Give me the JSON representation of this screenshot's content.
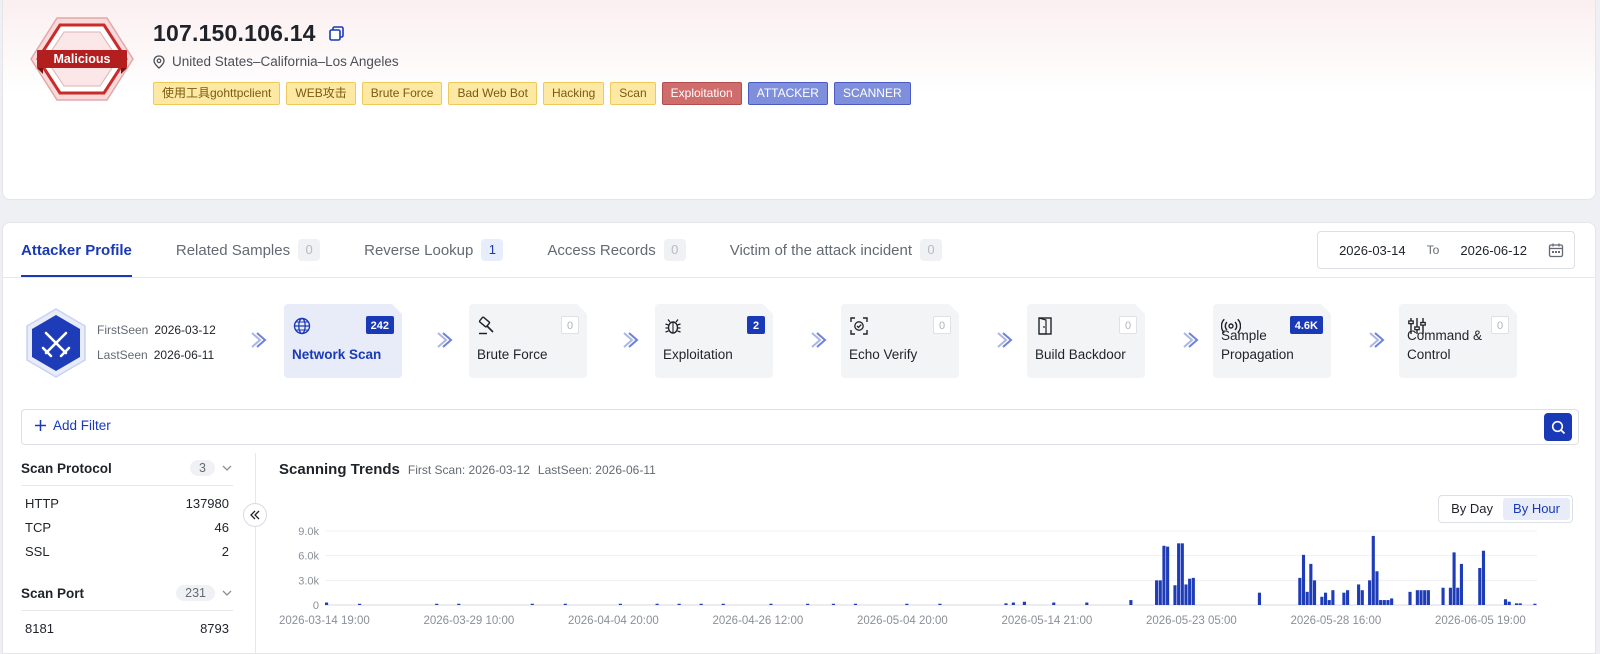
{
  "header": {
    "verdict_badge": "Malicious",
    "ip": "107.150.106.14",
    "location": "United States–California–Los Angeles",
    "tags": [
      {
        "label": "使用工具gohttpclient",
        "style": "yellow"
      },
      {
        "label": "WEB攻击",
        "style": "yellow"
      },
      {
        "label": "Brute Force",
        "style": "yellow"
      },
      {
        "label": "Bad Web Bot",
        "style": "yellow"
      },
      {
        "label": "Hacking",
        "style": "yellow"
      },
      {
        "label": "Scan",
        "style": "yellow"
      },
      {
        "label": "Exploitation",
        "style": "red"
      },
      {
        "label": "ATTACKER",
        "style": "blue"
      },
      {
        "label": "SCANNER",
        "style": "blue"
      }
    ]
  },
  "tabs": [
    {
      "label": "Attacker Profile",
      "active": true
    },
    {
      "label": "Related Samples",
      "count": "0"
    },
    {
      "label": "Reverse Lookup",
      "count": "1"
    },
    {
      "label": "Access Records",
      "count": "0"
    },
    {
      "label": "Victim of the attack incident",
      "count": "0"
    }
  ],
  "date_range": {
    "from": "2026-03-14",
    "to_label": "To",
    "to": "2026-06-12"
  },
  "attacker": {
    "first_seen_label": "FirstSeen",
    "first_seen": "2026-03-12",
    "last_seen_label": "LastSeen",
    "last_seen": "2026-06-11"
  },
  "kill_chain": [
    {
      "label": "Network Scan",
      "count": "242",
      "icon": "globe-icon",
      "active": true
    },
    {
      "label": "Brute Force",
      "count": "0",
      "icon": "hammer-icon"
    },
    {
      "label": "Exploitation",
      "count": "2",
      "icon": "bug-icon"
    },
    {
      "label": "Echo Verify",
      "count": "0",
      "icon": "scan-verify-icon"
    },
    {
      "label": "Build Backdoor",
      "count": "0",
      "icon": "door-icon"
    },
    {
      "label": "Sample Propagation",
      "count": "4.6K",
      "icon": "broadcast-icon"
    },
    {
      "label": "Command & Control",
      "count": "0",
      "icon": "sliders-icon"
    }
  ],
  "filter": {
    "add_label": "Add Filter"
  },
  "stats": {
    "protocol": {
      "title": "Scan Protocol",
      "count": "3",
      "rows": [
        {
          "name": "HTTP",
          "value": "137980"
        },
        {
          "name": "TCP",
          "value": "46"
        },
        {
          "name": "SSL",
          "value": "2"
        }
      ]
    },
    "port": {
      "title": "Scan Port",
      "count": "231",
      "rows": [
        {
          "name": "8181",
          "value": "8793"
        }
      ]
    }
  },
  "chart": {
    "title": "Scanning Trends",
    "first_scan": "First Scan: 2026-03-12",
    "last_seen": "LastSeen: 2026-06-11",
    "toggle": [
      {
        "label": "By Day"
      },
      {
        "label": "By Hour",
        "active": true
      }
    ]
  },
  "colors": {
    "accent": "#1939b7",
    "bar": "#1f3cb8"
  },
  "chart_data": {
    "type": "bar",
    "ylim": [
      0,
      9000
    ],
    "yticks": [
      "0",
      "3.0k",
      "6.0k",
      "9.0k"
    ],
    "xticks": [
      "2026-03-14 19:00",
      "2026-03-29 10:00",
      "2026-04-04 20:00",
      "2026-04-26 12:00",
      "2026-05-04 20:00",
      "2026-05-14 21:00",
      "2026-05-23 05:00",
      "2026-05-28 16:00",
      "2026-06-05 19:00"
    ],
    "values": [
      300,
      0,
      0,
      0,
      0,
      0,
      0,
      0,
      0,
      150,
      0,
      0,
      0,
      0,
      0,
      0,
      0,
      0,
      0,
      0,
      0,
      0,
      0,
      0,
      0,
      0,
      0,
      0,
      0,
      0,
      150,
      0,
      0,
      0,
      0,
      0,
      150,
      0,
      0,
      0,
      0,
      0,
      0,
      0,
      0,
      0,
      0,
      0,
      0,
      0,
      0,
      0,
      0,
      0,
      0,
      0,
      150,
      0,
      0,
      0,
      0,
      0,
      0,
      0,
      0,
      150,
      0,
      0,
      0,
      0,
      0,
      0,
      0,
      0,
      0,
      0,
      0,
      0,
      0,
      0,
      150,
      0,
      0,
      0,
      0,
      0,
      0,
      0,
      0,
      0,
      150,
      0,
      0,
      0,
      0,
      0,
      150,
      0,
      0,
      0,
      0,
      0,
      150,
      0,
      0,
      0,
      0,
      0,
      150,
      0,
      0,
      0,
      0,
      0,
      0,
      0,
      0,
      0,
      0,
      0,
      0,
      150,
      0,
      0,
      0,
      0,
      0,
      0,
      0,
      0,
      0,
      150,
      0,
      0,
      0,
      0,
      0,
      0,
      150,
      0,
      0,
      0,
      0,
      0,
      150,
      0,
      0,
      0,
      0,
      0,
      0,
      0,
      0,
      0,
      0,
      0,
      0,
      0,
      150,
      0,
      0,
      0,
      0,
      0,
      0,
      0,
      0,
      150,
      0,
      0,
      0,
      0,
      0,
      0,
      0,
      0,
      0,
      0,
      0,
      0,
      0,
      0,
      0,
      0,
      0,
      200,
      0,
      300,
      0,
      0,
      400,
      0,
      0,
      0,
      0,
      0,
      0,
      0,
      300,
      0,
      0,
      0,
      0,
      0,
      0,
      0,
      0,
      300,
      0,
      0,
      0,
      0,
      0,
      0,
      0,
      0,
      0,
      0,
      0,
      600,
      0,
      0,
      0,
      0,
      0,
      0,
      3000,
      3000,
      7200,
      7100,
      0,
      2400,
      7500,
      7500,
      2500,
      3200,
      3300,
      0,
      0,
      0,
      0,
      0,
      0,
      0,
      0,
      0,
      0,
      0,
      0,
      0,
      0,
      0,
      0,
      0,
      1500,
      0,
      0,
      0,
      0,
      0,
      0,
      0,
      0,
      0,
      0,
      3300,
      6100,
      1600,
      5000,
      3000,
      0,
      1000,
      1500,
      600,
      1800,
      0,
      0,
      1500,
      1800,
      0,
      0,
      2500,
      1800,
      0,
      3000,
      8400,
      4100,
      600,
      600,
      600,
      800,
      0,
      0,
      0,
      0,
      1600,
      0,
      1800,
      1800,
      1800,
      1800,
      0,
      0,
      0,
      2100,
      0,
      2100,
      6400,
      2100,
      5000,
      0,
      0,
      0,
      0,
      4500,
      6600,
      0,
      0,
      0,
      0,
      0,
      700,
      400,
      0,
      200,
      200,
      0,
      0,
      0,
      150
    ]
  }
}
